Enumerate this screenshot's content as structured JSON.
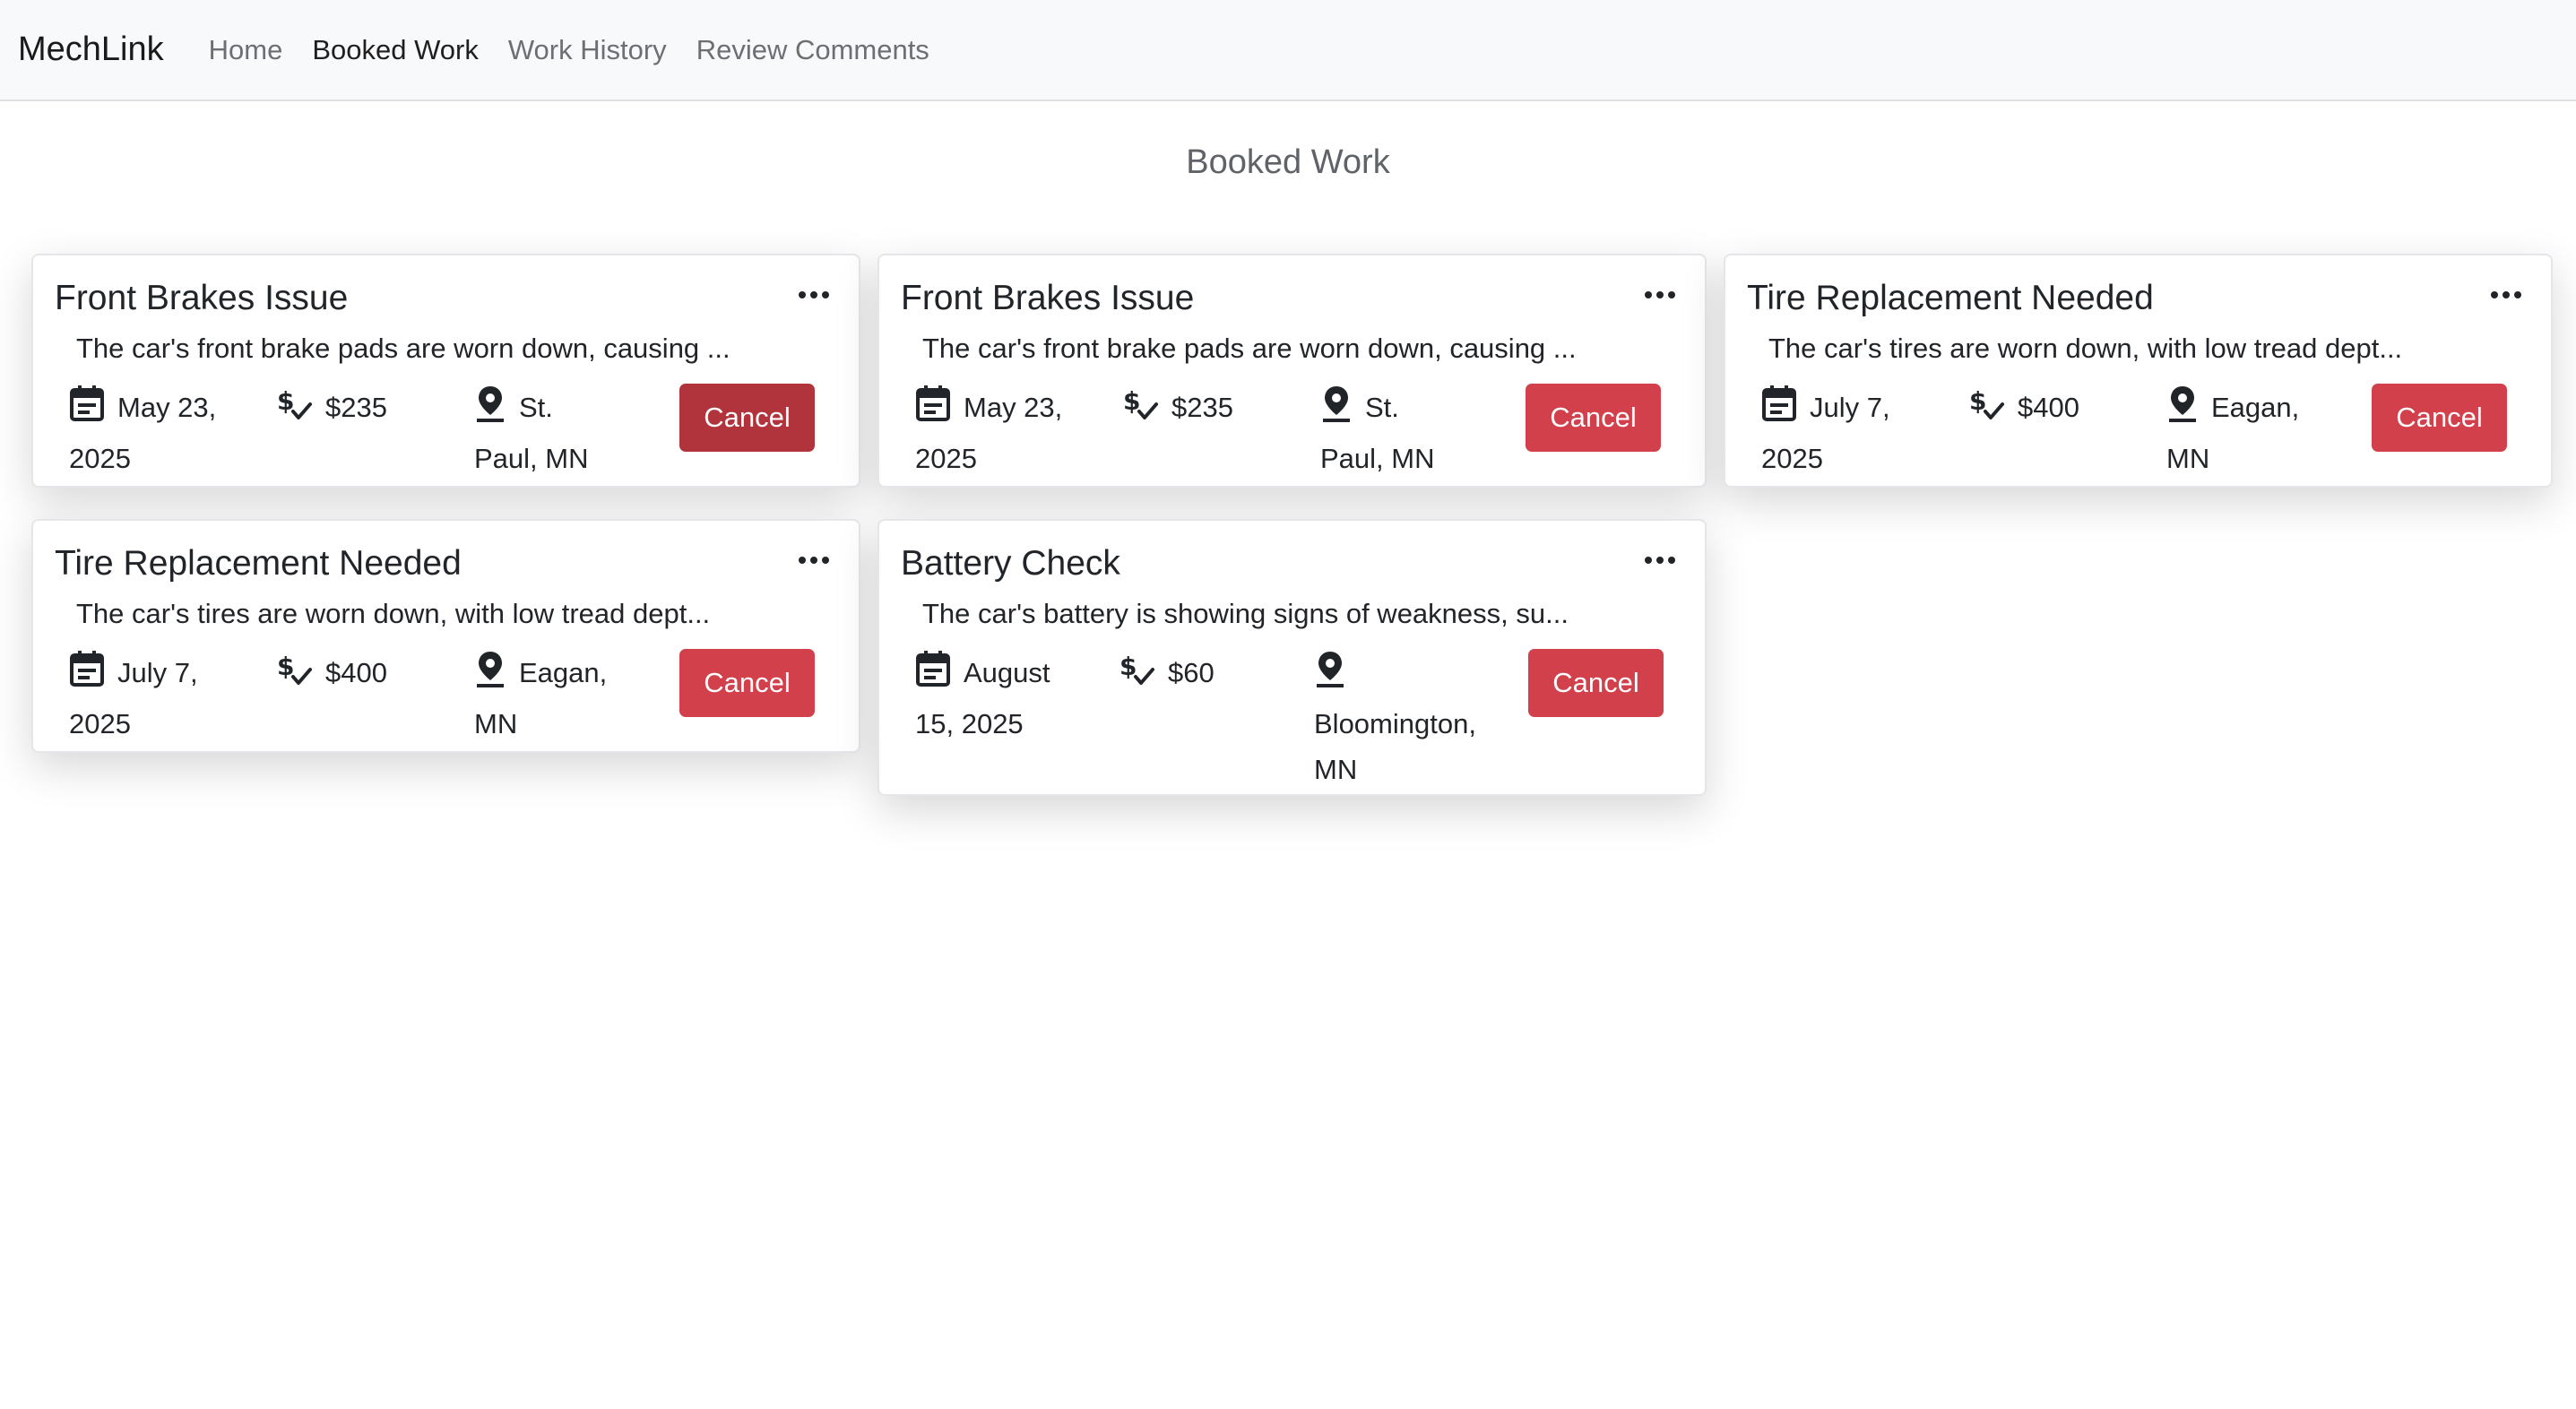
{
  "app": {
    "brand": "MechLink"
  },
  "nav": {
    "home": "Home",
    "booked": "Booked Work",
    "history": "Work History",
    "reviews": "Review Comments"
  },
  "page": {
    "title": "Booked Work"
  },
  "cards": [
    {
      "title": "Front Brakes Issue",
      "desc": "The car's front brake pads are worn down, causing ...",
      "date_line1": "May 23,",
      "date_line2": "2025",
      "price": "$235",
      "loc_line1": "St.",
      "loc_line2": "Paul, MN",
      "cancel": "Cancel"
    },
    {
      "title": "Front Brakes Issue",
      "desc": "The car's front brake pads are worn down, causing ...",
      "date_line1": "May 23,",
      "date_line2": "2025",
      "price": "$235",
      "loc_line1": "St.",
      "loc_line2": "Paul, MN",
      "cancel": "Cancel"
    },
    {
      "title": "Tire Replacement Needed",
      "desc": "The car's tires are worn down, with low tread dept...",
      "date_line1": "July 7,",
      "date_line2": "2025",
      "price": "$400",
      "loc_line1": "Eagan,",
      "loc_line2": "MN",
      "cancel": "Cancel"
    },
    {
      "title": "Tire Replacement Needed",
      "desc": "The car's tires are worn down, with low tread dept...",
      "date_line1": "July 7,",
      "date_line2": "2025",
      "price": "$400",
      "loc_line1": "Eagan,",
      "loc_line2": "MN",
      "cancel": "Cancel"
    },
    {
      "title": "Battery Check",
      "desc": "The car's battery is showing signs of weakness, su...",
      "date_line1": "August",
      "date_line2": "15, 2025",
      "price": "$60",
      "loc_line1": "",
      "loc_line2": "Bloomington,",
      "loc_line3": "MN",
      "cancel": "Cancel"
    }
  ],
  "icons": {
    "more": "more-horizontal-icon",
    "date": "calendar-icon",
    "price": "dollar-check-icon",
    "location": "map-pin-icon"
  }
}
